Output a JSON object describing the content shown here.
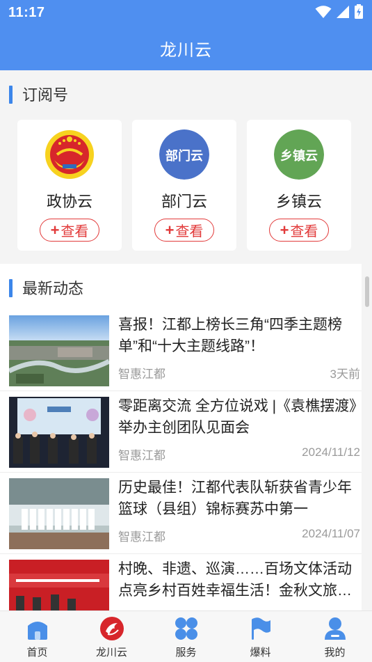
{
  "status": {
    "time": "11:17"
  },
  "header": {
    "title": "龙川云"
  },
  "subscriptions": {
    "title": "订阅号",
    "items": [
      {
        "name": "政协云",
        "button": "查看",
        "logo": "cppcc-emblem"
      },
      {
        "name": "部门云",
        "button": "查看",
        "logo_text": "部门云",
        "color": "#4a72c9"
      },
      {
        "name": "乡镇云",
        "button": "查看",
        "logo_text": "乡镇云",
        "color": "#62a555"
      }
    ]
  },
  "news": {
    "title": "最新动态",
    "items": [
      {
        "title": "喜报！江都上榜长三角“四季主题榜单”和“十大主题线路”！",
        "source": "智惠江都",
        "time": "3天前"
      },
      {
        "title": "零距离交流 全方位说戏 |《袁樵摆渡》举办主创团队见面会",
        "source": "智惠江都",
        "time": "2024/11/12"
      },
      {
        "title": "历史最佳！江都代表队斩获省青少年篮球（县组）锦标赛苏中第一",
        "source": "智惠江都",
        "time": "2024/11/07"
      },
      {
        "title": "村晚、非遗、巡演……百场文体活动点亮乡村百姓幸福生活！金秋文旅…",
        "source": "",
        "time": ""
      }
    ]
  },
  "tabbar": {
    "items": [
      {
        "label": "首页",
        "icon": "home-icon"
      },
      {
        "label": "龙川云",
        "icon": "longchuan-logo-icon"
      },
      {
        "label": "服务",
        "icon": "services-icon"
      },
      {
        "label": "爆料",
        "icon": "flag-icon"
      },
      {
        "label": "我的",
        "icon": "user-icon"
      }
    ]
  },
  "colors": {
    "accent": "#4f8ff0",
    "red": "#e23b3b",
    "brand_red": "#d7262b"
  }
}
